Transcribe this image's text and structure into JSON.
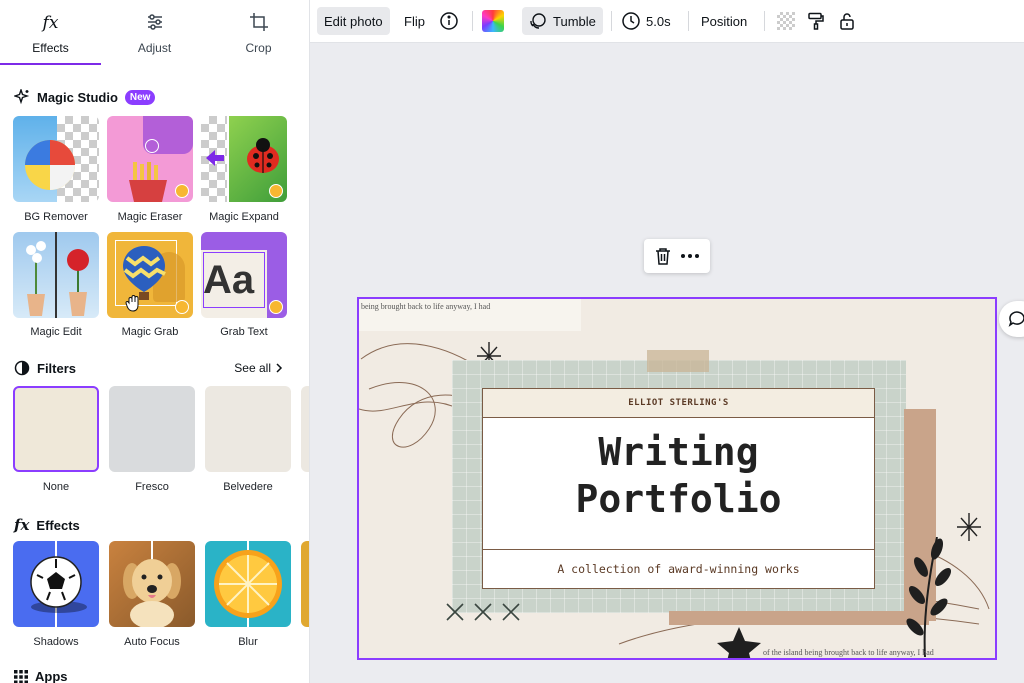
{
  "tabs": [
    {
      "label": "Effects",
      "icon": "fx-icon"
    },
    {
      "label": "Adjust",
      "icon": "sliders-icon"
    },
    {
      "label": "Crop",
      "icon": "crop-icon"
    }
  ],
  "magic_studio": {
    "title": "Magic Studio",
    "badge": "New",
    "items": [
      {
        "label": "BG Remover"
      },
      {
        "label": "Magic Eraser"
      },
      {
        "label": "Magic Expand"
      },
      {
        "label": "Magic Edit"
      },
      {
        "label": "Magic Grab"
      },
      {
        "label": "Grab Text"
      }
    ]
  },
  "filters": {
    "title": "Filters",
    "see_all": "See all",
    "items": [
      {
        "label": "None",
        "color": "#efe8d9"
      },
      {
        "label": "Fresco",
        "color": "#d9dbdd"
      },
      {
        "label": "Belvedere",
        "color": "#ece8e1"
      }
    ]
  },
  "effects": {
    "title": "Effects",
    "items": [
      {
        "label": "Shadows"
      },
      {
        "label": "Auto Focus"
      },
      {
        "label": "Blur"
      }
    ]
  },
  "apps": {
    "title": "Apps"
  },
  "toolbar": {
    "edit_photo": "Edit photo",
    "flip": "Flip",
    "tumble": "Tumble",
    "duration": "5.0s",
    "position": "Position"
  },
  "design": {
    "torn_text_top": "being brought back to life anyway, I had",
    "author": "ELLIOT STERLING'S",
    "title_line1": "Writing",
    "title_line2": "Portfolio",
    "subtitle": "A collection of award-winning works",
    "torn_text_bottom": "of the island being brought back to life anyway, I had"
  },
  "colors": {
    "accent": "#8b3dff",
    "active_tab": "#7d2ae8"
  }
}
